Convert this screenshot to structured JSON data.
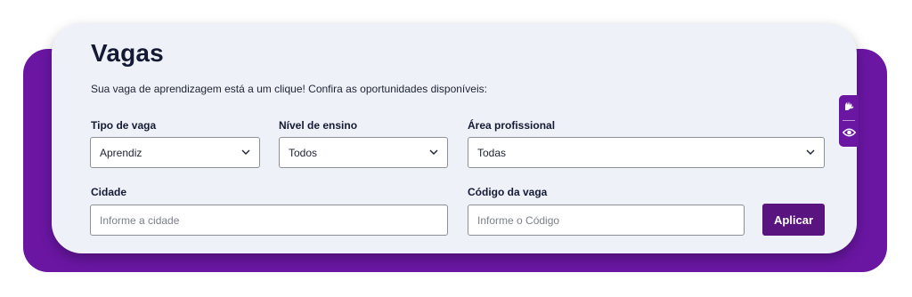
{
  "page": {
    "title": "Vagas",
    "subtitle": "Sua vaga de aprendizagem está a um clique! Confira as oportunidades disponíveis:"
  },
  "filters": {
    "tipo_vaga": {
      "label": "Tipo de vaga",
      "value": "Aprendiz"
    },
    "nivel_ensino": {
      "label": "Nível de ensino",
      "value": "Todos"
    },
    "area_profissional": {
      "label": "Área profissional",
      "value": "Todas"
    },
    "cidade": {
      "label": "Cidade",
      "placeholder": "Informe a cidade",
      "value": ""
    },
    "codigo_vaga": {
      "label": "Código da vaga",
      "placeholder": "Informe o Código",
      "value": ""
    }
  },
  "actions": {
    "apply_label": "Aplicar"
  },
  "accessibility_bar": {
    "items": [
      {
        "icon": "sign-language-icon"
      },
      {
        "icon": "eye-icon"
      }
    ]
  },
  "colors": {
    "brand_purple": "#6a16a3",
    "button_purple": "#5a1480",
    "card_background": "#eef2f8",
    "title_text": "#141a33"
  }
}
